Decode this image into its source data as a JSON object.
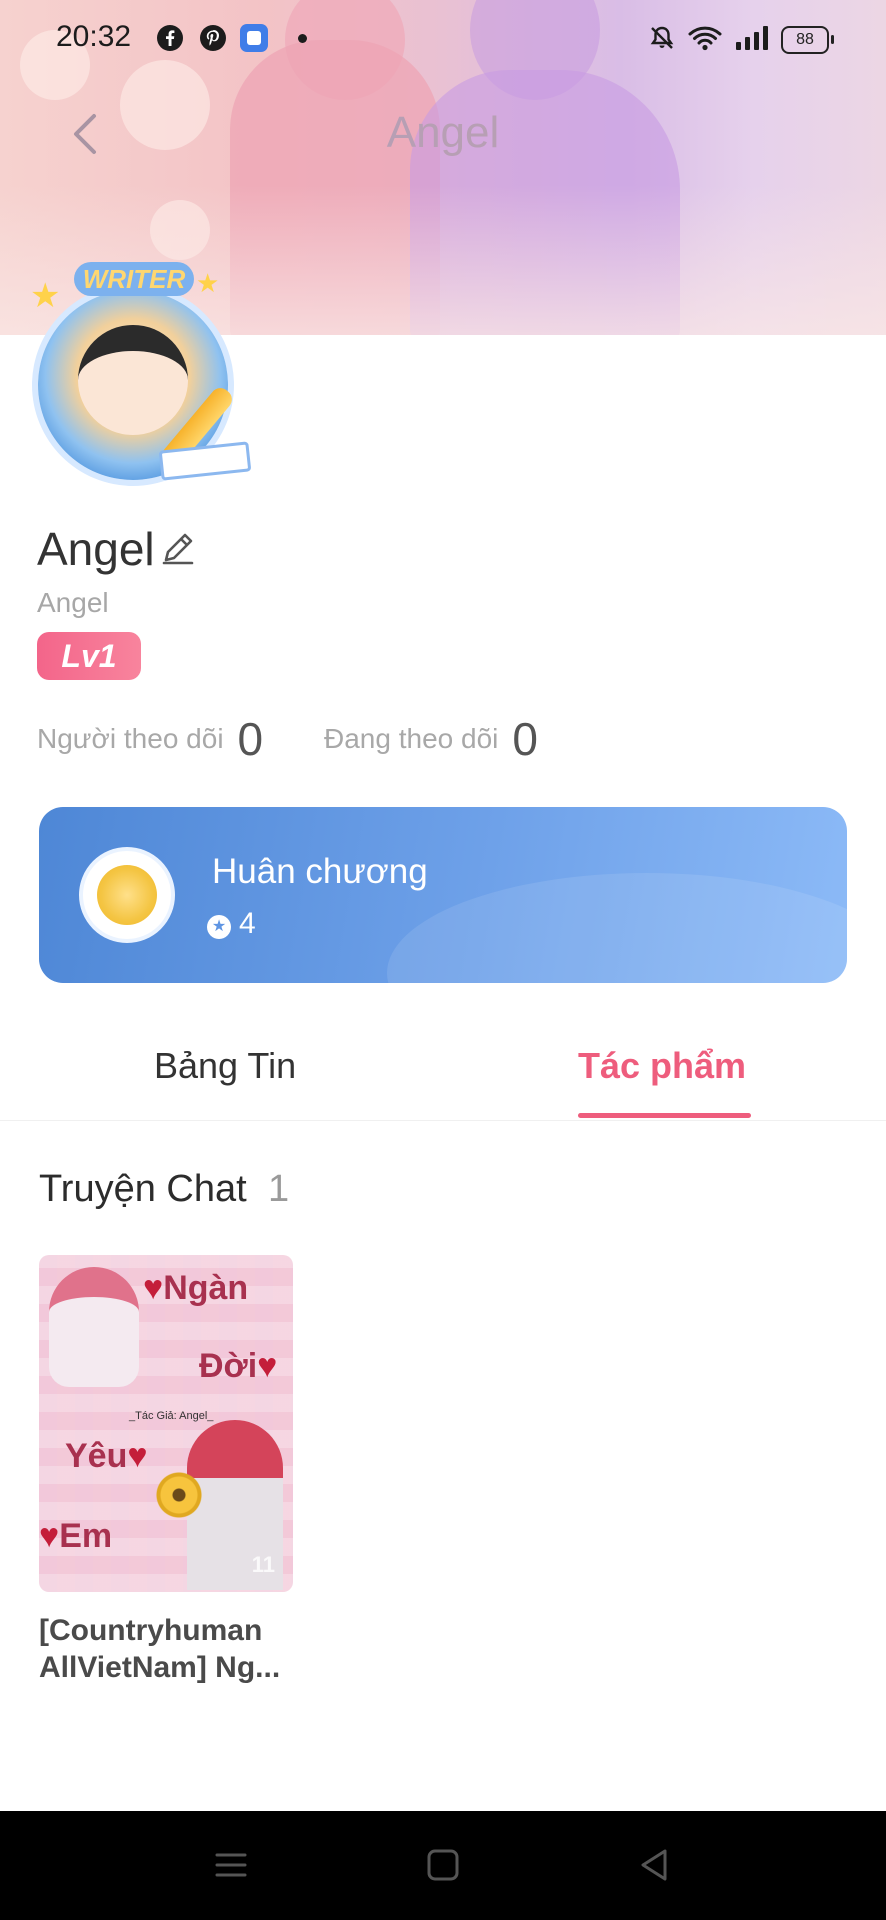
{
  "status_bar": {
    "time": "20:32",
    "battery": "88"
  },
  "header": {
    "title": "Angel"
  },
  "avatar": {
    "badge": "WRITER"
  },
  "profile": {
    "name": "Angel",
    "id": "Angel",
    "level": "Lv1"
  },
  "stats": {
    "followers_label": "Người theo dõi",
    "followers_count": "0",
    "following_label": "Đang theo dõi",
    "following_count": "0"
  },
  "medal": {
    "title": "Huân chương",
    "count": "4"
  },
  "tabs": [
    {
      "label": "Bảng Tin"
    },
    {
      "label": "Tác phẩm"
    }
  ],
  "section": {
    "title": "Truyện Chat",
    "count": "1"
  },
  "stories": [
    {
      "title": "[Countryhuman AllVietNam] Ng...",
      "cover_words": [
        "Ngàn",
        "Đời",
        "Yêu",
        "Em"
      ],
      "cover_author": "_Tác Giả: Angel_",
      "cover_number": "11"
    }
  ],
  "colors": {
    "accent": "#ee5d7d",
    "medal_card": "#5f95e3",
    "level_badge": "#f3658a"
  }
}
